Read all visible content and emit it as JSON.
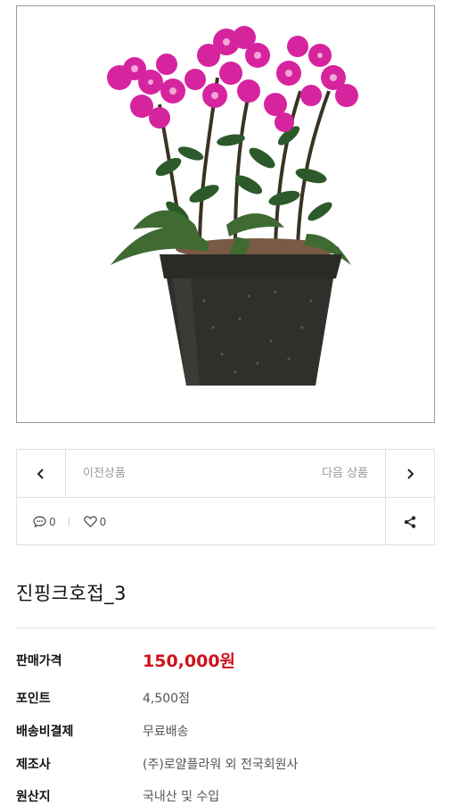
{
  "product_image": {
    "alt": "진핑크호접_3"
  },
  "navigation": {
    "prev_label": "이전상품",
    "next_label": "다음 상품",
    "prev_icon": "chevron-left-icon",
    "next_icon": "chevron-right-icon"
  },
  "stats": {
    "comment_count": "0",
    "like_count": "0",
    "comment_icon": "comment-icon",
    "like_icon": "heart-icon",
    "share_icon": "share-icon"
  },
  "product": {
    "title": "진핑크호접_3"
  },
  "info": {
    "price_label": "판매가격",
    "price_value": "150,000원",
    "point_label": "포인트",
    "point_value": "4,500점",
    "shipping_label": "배송비결제",
    "shipping_value": "무료배송",
    "maker_label": "제조사",
    "maker_value": "(주)로얄플라워 외 전국회원사",
    "origin_label": "원산지",
    "origin_value": "국내산 및 수입"
  },
  "colors": {
    "price": "#d0121b",
    "orchid": "#d6249f",
    "pot": "#2f302b"
  }
}
